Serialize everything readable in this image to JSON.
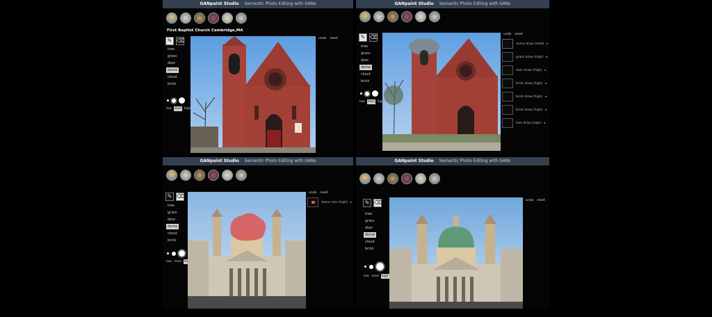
{
  "app": {
    "title": "GANpaint Studio",
    "subtitle": "Semantic Photo Editing with GANs"
  },
  "tools": {
    "brush_icon": "brush-icon",
    "eraser_icon": "eraser-icon"
  },
  "features": [
    "tree",
    "grass",
    "door",
    "dome",
    "cloud",
    "brick"
  ],
  "strengths": [
    "low",
    "med",
    "high"
  ],
  "actions": {
    "undo": "undo",
    "reset": "reset"
  },
  "panel_tl": {
    "caption": "First Baptist Church Cambridge,MA",
    "selected_feature": "dome"
  },
  "panel_tr": {
    "selected_feature": "dome",
    "history": [
      {
        "label": "dome draw (med)",
        "arrow": "▸"
      },
      {
        "label": "grass draw (high)",
        "arrow": "▸"
      },
      {
        "label": "door draw (high)",
        "arrow": "▸"
      },
      {
        "label": "brick draw (high)",
        "arrow": "▸"
      },
      {
        "label": "brick draw (high)",
        "arrow": "▸"
      },
      {
        "label": "brick draw (high)",
        "arrow": "▸"
      },
      {
        "label": "tree draw (high)",
        "arrow": "▸"
      }
    ]
  },
  "panel_bl": {
    "selected_feature": "dome",
    "history": [
      {
        "label": "dome rem (high)",
        "arrow": "▸"
      }
    ]
  },
  "panel_br": {
    "selected_feature": "dome"
  },
  "colors": {
    "header": "#34404f",
    "church_brick": "#a8433a",
    "sky": "#7fb1e6",
    "stone": "#c8b7a0",
    "dome_green": "#5e9a7a",
    "paint_red": "#e0504c"
  }
}
